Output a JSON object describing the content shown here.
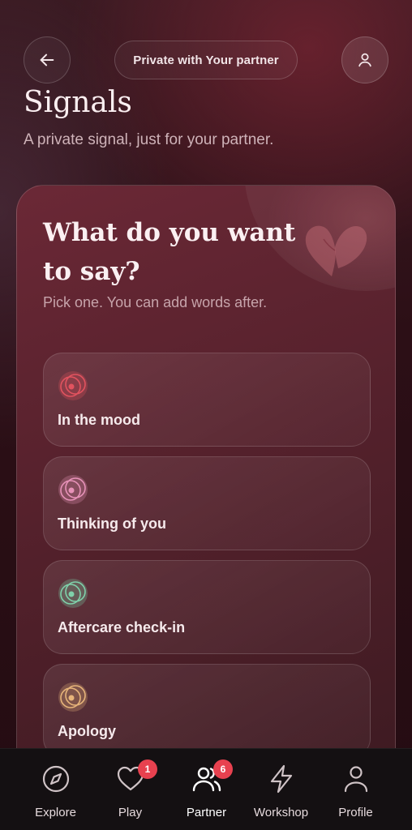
{
  "header": {
    "privacy_label": "Private with Your partner"
  },
  "page": {
    "title": "Signals",
    "subtitle": "A private signal, just for your partner."
  },
  "card": {
    "title": "What do you want to say?",
    "hint": "Pick one. You can add words after."
  },
  "options": [
    {
      "label": "In the mood",
      "icon": "signal-icon",
      "color": "#e2535f"
    },
    {
      "label": "Thinking of you",
      "icon": "signal-icon",
      "color": "#e792b8"
    },
    {
      "label": "Aftercare check-in",
      "icon": "signal-icon",
      "color": "#7fd1aa"
    },
    {
      "label": "Apology",
      "icon": "signal-icon",
      "color": "#e7b47a"
    }
  ],
  "nav": {
    "items": [
      {
        "label": "Explore",
        "icon": "compass-icon",
        "badge": ""
      },
      {
        "label": "Play",
        "icon": "heart-icon",
        "badge": "1"
      },
      {
        "label": "Partner",
        "icon": "partner-icon",
        "badge": "6"
      },
      {
        "label": "Workshop",
        "icon": "lightning-icon",
        "badge": ""
      },
      {
        "label": "Profile",
        "icon": "person-icon",
        "badge": ""
      }
    ]
  },
  "colors": {
    "accent": "#e8414f",
    "background": "#2c0f16",
    "card": "#5a2330"
  }
}
